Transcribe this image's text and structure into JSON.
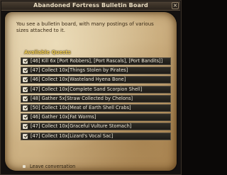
{
  "window": {
    "title": "Abandoned Fortress Bulletin Board",
    "close_symbol": "×",
    "close_icon": "close-icon"
  },
  "intro_text": "You see a bulletin board, with many postings of various sizes attached to it.",
  "available_quests_label": "Available Quests",
  "quests": [
    {
      "label": "[46] Kill 6x [Port Robbers], [Port Rascals], [Port Bandits]]"
    },
    {
      "label": "[47] Collect 10x[Things Stolen by Pirates]"
    },
    {
      "label": "[46] Collect 10x[Wasteland Hyena Bone]"
    },
    {
      "label": "[47] Collect 10x[Complete Sand Scorpion Shell]"
    },
    {
      "label": "[48] Gather 5x[Straw Collected by Chelons]"
    },
    {
      "label": "[50] Collect 10x[Meat of Earth Shell Crabs]"
    },
    {
      "label": "[46] Gather 10x[Fat Worms]"
    },
    {
      "label": "[47] Collect 10x[Graceful Vulture Stomach]"
    },
    {
      "label": "[47] Collect 10x[Lizard's Vocal Sac]"
    }
  ],
  "leave_label": "Leave conversation",
  "colors": {
    "header_gold": "#f0cf5a",
    "row_bg": "#2f2c26",
    "parchment": "#cfb486"
  }
}
